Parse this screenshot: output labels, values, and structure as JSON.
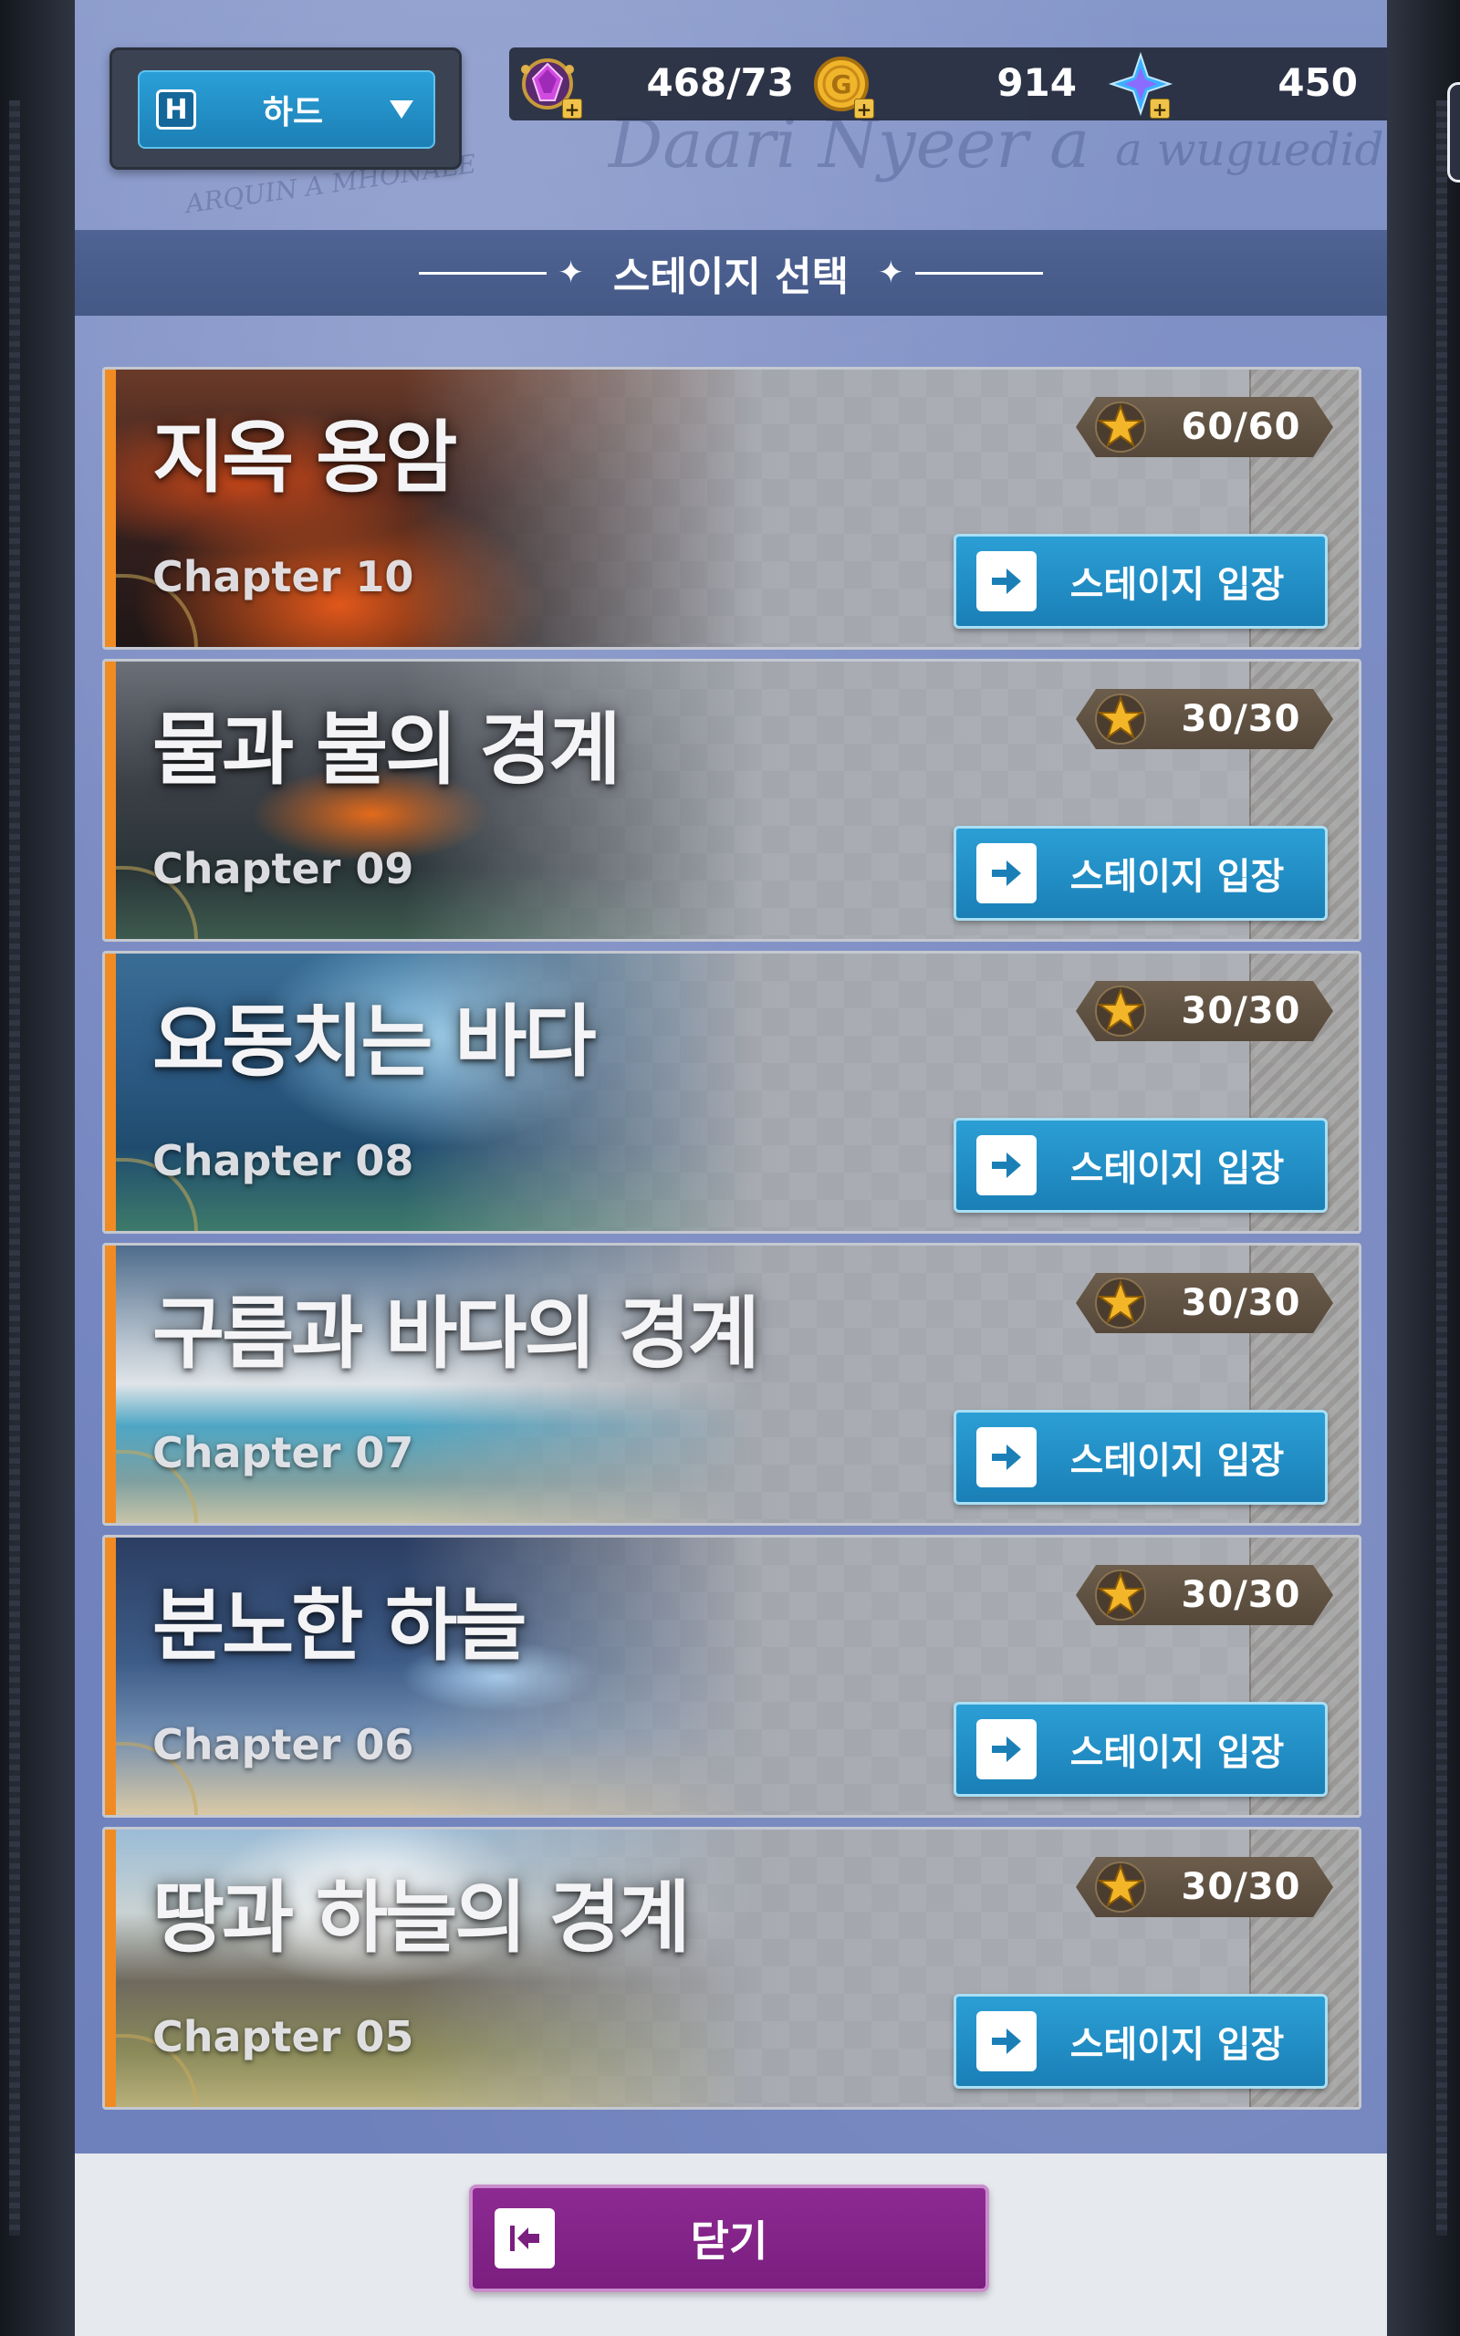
{
  "difficulty": {
    "badge": "H",
    "label": "하드"
  },
  "resources": [
    {
      "icon": "purple-gem-icon",
      "value": "468/73"
    },
    {
      "icon": "gold-coin-icon",
      "value": "914"
    },
    {
      "icon": "blue-crystal-icon",
      "value": "450"
    }
  ],
  "background_text": [
    "Daari Nyeer a",
    "a wuguedid",
    "ARQUIN A MHONALE"
  ],
  "header": {
    "title": "스테이지 선택"
  },
  "chapters": [
    {
      "title": "지옥 용암",
      "chapter": "Chapter 10",
      "stars": "60/60",
      "button": "스테이지 입장",
      "theme": "lava"
    },
    {
      "title": "물과 불의 경계",
      "chapter": "Chapter 09",
      "stars": "30/30",
      "button": "스테이지 입장",
      "theme": "shore-lava"
    },
    {
      "title": "요동치는 바다",
      "chapter": "Chapter 08",
      "stars": "30/30",
      "button": "스테이지 입장",
      "theme": "sea"
    },
    {
      "title": "구름과 바다의 경계",
      "chapter": "Chapter 07",
      "stars": "30/30",
      "button": "스테이지 입장",
      "theme": "clouds-sea"
    },
    {
      "title": "분노한 하늘",
      "chapter": "Chapter 06",
      "stars": "30/30",
      "button": "스테이지 입장",
      "theme": "storm"
    },
    {
      "title": "땅과 하늘의 경계",
      "chapter": "Chapter 05",
      "stars": "30/30",
      "button": "스테이지 입장",
      "theme": "cliffs"
    }
  ],
  "footer": {
    "close_label": "닫기"
  },
  "colors": {
    "accent_orange": "#f08b23",
    "enter_button": "#1f8cc3",
    "close_button": "#86258b",
    "panel_blue": "#7384bf"
  }
}
